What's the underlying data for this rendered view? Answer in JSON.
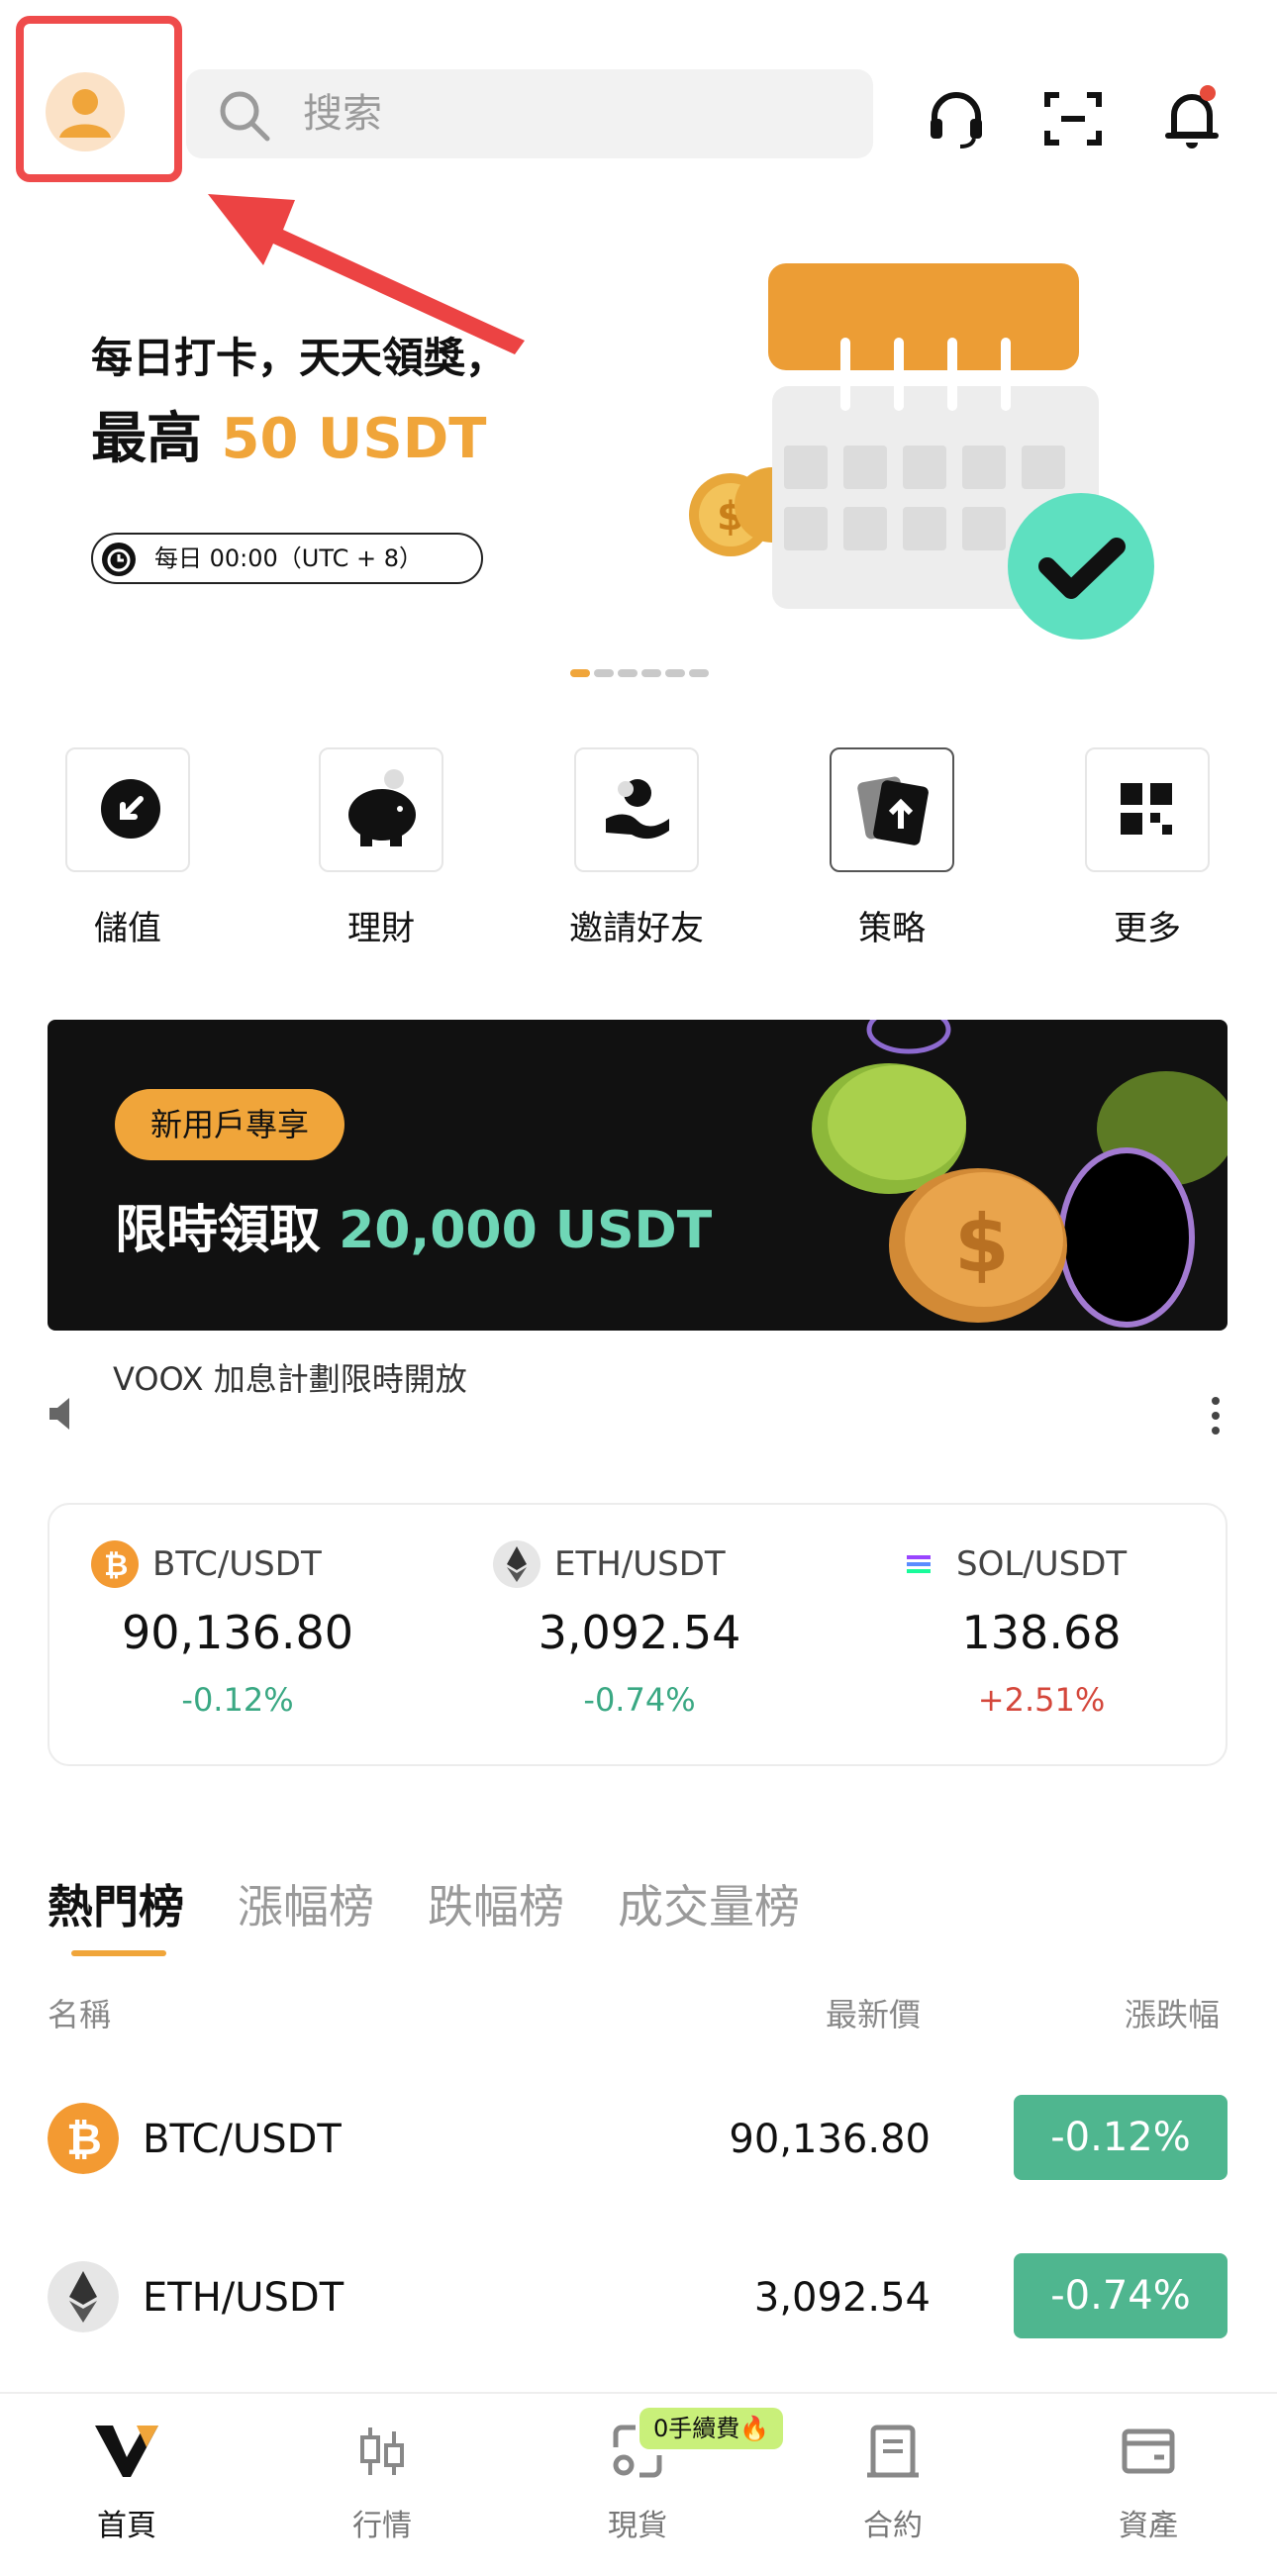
{
  "search": {
    "placeholder": "搜索"
  },
  "hero": {
    "line1": "每日打卡，天天領獎，",
    "line2_prefix": "最高 ",
    "line2_amount": "50 USDT",
    "pill": "每日 00:00（UTC + 8）"
  },
  "quick_actions": [
    {
      "label": "儲值",
      "icon": "deposit-icon"
    },
    {
      "label": "理財",
      "icon": "piggy-bank-icon"
    },
    {
      "label": "邀請好友",
      "icon": "invite-friends-icon"
    },
    {
      "label": "策略",
      "icon": "strategy-icon"
    },
    {
      "label": "更多",
      "icon": "more-grid-icon"
    }
  ],
  "promo": {
    "tag": "新用戶專享",
    "title_prefix": "限時領取 ",
    "title_amount": "20,000 USDT"
  },
  "announcement": "VOOX 加息計劃限時開放",
  "tickers": [
    {
      "pair": "BTC/USDT",
      "price": "90,136.80",
      "change": "-0.12%",
      "direction": "down"
    },
    {
      "pair": "ETH/USDT",
      "price": "3,092.54",
      "change": "-0.74%",
      "direction": "down"
    },
    {
      "pair": "SOL/USDT",
      "price": "138.68",
      "change": "+2.51%",
      "direction": "up"
    }
  ],
  "tabs": [
    "熱門榜",
    "漲幅榜",
    "跌幅榜",
    "成交量榜"
  ],
  "table": {
    "headers": {
      "name": "名稱",
      "price": "最新價",
      "change": "漲跌幅"
    },
    "rows": [
      {
        "pair": "BTC/USDT",
        "price": "90,136.80",
        "change": "-0.12%"
      },
      {
        "pair": "ETH/USDT",
        "price": "3,092.54",
        "change": "-0.74%"
      }
    ]
  },
  "bottom_nav": {
    "items": [
      "首頁",
      "行情",
      "現貨",
      "合約",
      "資產"
    ],
    "fee_badge": "0手續費🔥"
  },
  "colors": {
    "accent": "#f0a53a",
    "up_green": "#3aa883",
    "down_red": "#d4473b",
    "badge_green": "#4fb68f",
    "highlight_red": "#ef4b4b"
  }
}
